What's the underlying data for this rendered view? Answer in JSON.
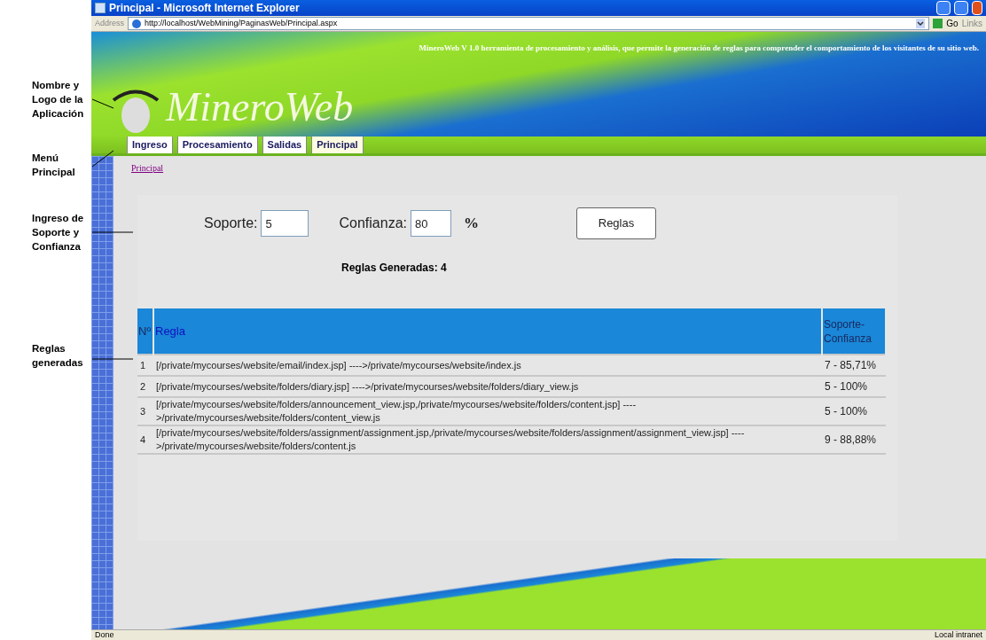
{
  "annotations": [
    "Nombre y Logo de la Aplicación",
    "Menú Principal",
    "Ingreso de Soporte y Confianza",
    "Reglas generadas"
  ],
  "window": {
    "title": "Principal - Microsoft Internet Explorer"
  },
  "address_bar": {
    "label": "Address",
    "url": "http://localhost/WebMining/PaginasWeb/Principal.aspx",
    "go": "Go",
    "links": "Links"
  },
  "header": {
    "logo": "MineroWeb",
    "description": "MineroWeb V 1.0 herramienta de procesamiento y análisis, que permite la generación de reglas para comprender el comportamiento de los visitantes de su sitio web."
  },
  "menu": [
    {
      "label": "Ingreso",
      "selected": false
    },
    {
      "label": "Procesamiento",
      "selected": false
    },
    {
      "label": "Salidas",
      "selected": false
    },
    {
      "label": "Principal",
      "selected": true
    }
  ],
  "breadcrumb": "Principal",
  "form": {
    "soporte_label": "Soporte:",
    "soporte_value": "5",
    "confianza_label": "Confianza:",
    "confianza_value": "80",
    "percent": "%",
    "button": "Reglas",
    "count_text": "Reglas Generadas: 4"
  },
  "table": {
    "columns": [
      "Nº",
      "Regla",
      "Soporte-Confianza"
    ],
    "rows": [
      [
        "1",
        "[/private/mycourses/website/email/index.jsp] ---->/private/mycourses/website/index.js",
        "7 - 85,71%"
      ],
      [
        "2",
        "[/private/mycourses/website/folders/diary.jsp] ---->/private/mycourses/website/folders/diary_view.js",
        "5 - 100%"
      ],
      [
        "3",
        "[/private/mycourses/website/folders/announcement_view.jsp,/private/mycourses/website/folders/content.jsp] ---->/private/mycourses/website/folders/content_view.js",
        "5 - 100%"
      ],
      [
        "4",
        "[/private/mycourses/website/folders/assignment/assignment.jsp,/private/mycourses/website/folders/assignment/assignment_view.jsp] ---->/private/mycourses/website/folders/content.js",
        "9 - 88,88%"
      ]
    ]
  },
  "status_bar": {
    "left": "Done",
    "right": "Local intranet"
  }
}
